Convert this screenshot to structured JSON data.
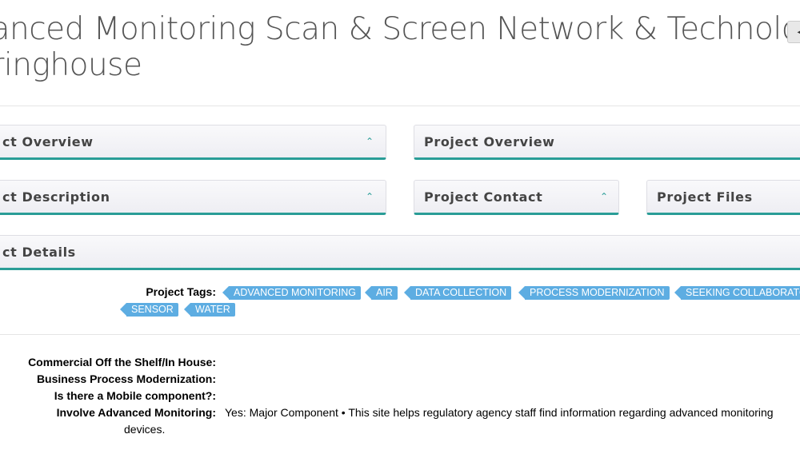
{
  "page": {
    "title_line1": "vanced Monitoring Scan & Screen Network & Technology",
    "title_line2": "aringhouse",
    "title_button_icon": "◂"
  },
  "panels": {
    "left_overview": "ct Overview",
    "right_overview": "Project Overview",
    "left_description": "ct Description",
    "contact": "Project Contact",
    "files": "Project Files",
    "details": "ct Details"
  },
  "tags": {
    "label": "Project Tags:",
    "items": [
      "ADVANCED MONITORING",
      "AIR",
      "DATA COLLECTION",
      "PROCESS MODERNIZATION",
      "SEEKING COLLABORATO",
      "SENSOR",
      "WATER"
    ]
  },
  "fields": {
    "cots_label": "Commercial Off the Shelf/In House:",
    "bpm_label": "Business Process Modernization:",
    "mobile_label": "Is there a Mobile component?:",
    "monitoring_label": "Involve Advanced Monitoring:",
    "monitoring_value": "Yes: Major Component • This site helps regulatory agency staff find information regarding advanced monitoring",
    "monitoring_value_cont": "devices."
  },
  "colors": {
    "accent": "#2a9d97",
    "tag": "#5dade2"
  },
  "icons": {
    "chevron": "chevron-up-icon"
  }
}
